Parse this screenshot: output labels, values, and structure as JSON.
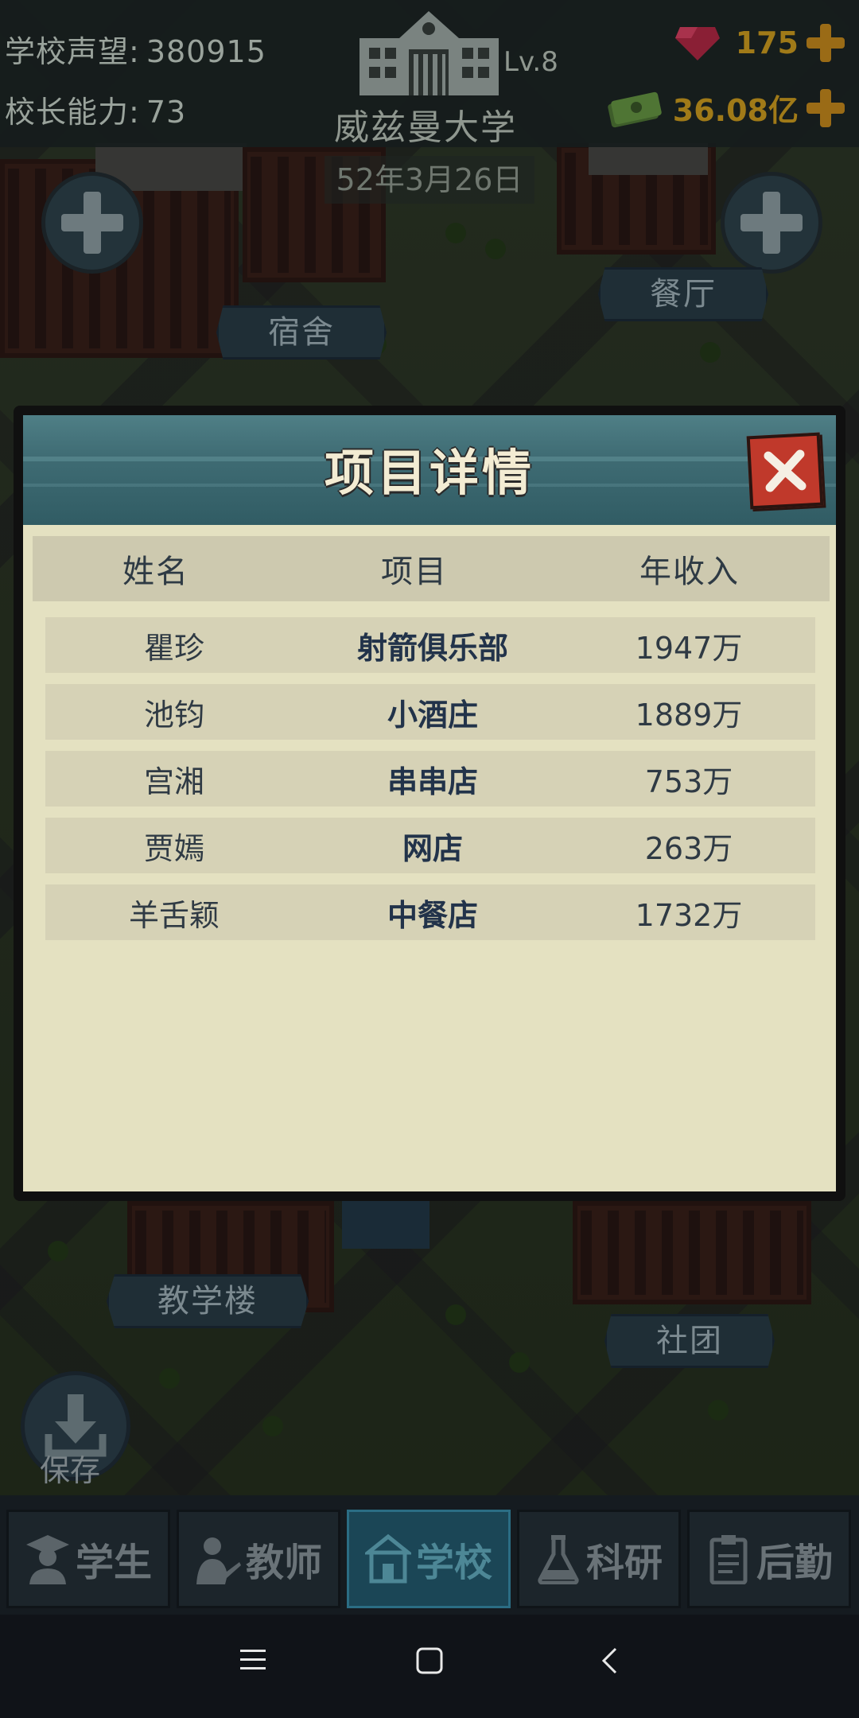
{
  "hud": {
    "reputation_label": "学校声望:",
    "reputation_value": "380915",
    "ability_label": "校长能力:",
    "ability_value": "73",
    "level": "Lv.8",
    "school_name": "威兹曼大学",
    "gems": "175",
    "money": "36.08亿",
    "date": "52年3月26日"
  },
  "map": {
    "labels": {
      "dorm": "宿舍",
      "canteen": "餐厅",
      "teaching": "教学楼",
      "club": "社团"
    },
    "save_label": "保存"
  },
  "modal": {
    "title": "项目详情",
    "columns": [
      "姓名",
      "项目",
      "年收入"
    ],
    "rows": [
      {
        "name": "瞿珍",
        "project": "射箭俱乐部",
        "income": "1947万"
      },
      {
        "name": "池钧",
        "project": "小酒庄",
        "income": "1889万"
      },
      {
        "name": "宫湘",
        "project": "串串店",
        "income": "753万"
      },
      {
        "name": "贾嫣",
        "project": "网店",
        "income": "263万"
      },
      {
        "name": "羊舌颖",
        "project": "中餐店",
        "income": "1732万"
      }
    ]
  },
  "tabs": [
    {
      "label": "学生",
      "icon": "student-icon"
    },
    {
      "label": "教师",
      "icon": "teacher-icon"
    },
    {
      "label": "学校",
      "icon": "school-icon",
      "active": true
    },
    {
      "label": "科研",
      "icon": "flask-icon"
    },
    {
      "label": "后勤",
      "icon": "clipboard-icon"
    }
  ],
  "colors": {
    "accent_gold": "#a07a18",
    "modal_body": "#e4e1c1",
    "active_tab": "#1b4656",
    "close_red": "#c0392b"
  }
}
